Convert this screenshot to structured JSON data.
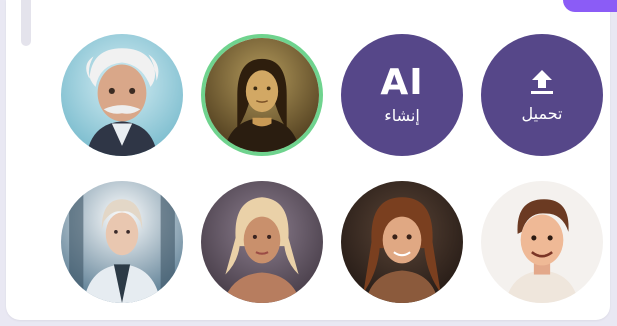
{
  "actions": {
    "generate": {
      "icon_text": "AI",
      "label": "إنشاء"
    },
    "upload": {
      "label": "تحميل"
    }
  },
  "avatars": [
    {
      "id": "einstein",
      "selected": false,
      "icon": "einstein-portrait"
    },
    {
      "id": "mona-lisa",
      "selected": true,
      "icon": "mona-lisa-portrait"
    },
    {
      "id": "cyborg-woman",
      "selected": false,
      "icon": "cyborg-woman-portrait"
    },
    {
      "id": "blonde-woman",
      "selected": false,
      "icon": "blonde-woman-portrait"
    },
    {
      "id": "brunette-woman",
      "selected": false,
      "icon": "brunette-woman-portrait"
    },
    {
      "id": "cartoon-man",
      "selected": false,
      "icon": "cartoon-man-portrait"
    }
  ],
  "colors": {
    "action_bg": "#564789",
    "selected_ring": "#6fd38e",
    "accent": "#8b5cf6",
    "page_bg": "#e9e8f3"
  }
}
